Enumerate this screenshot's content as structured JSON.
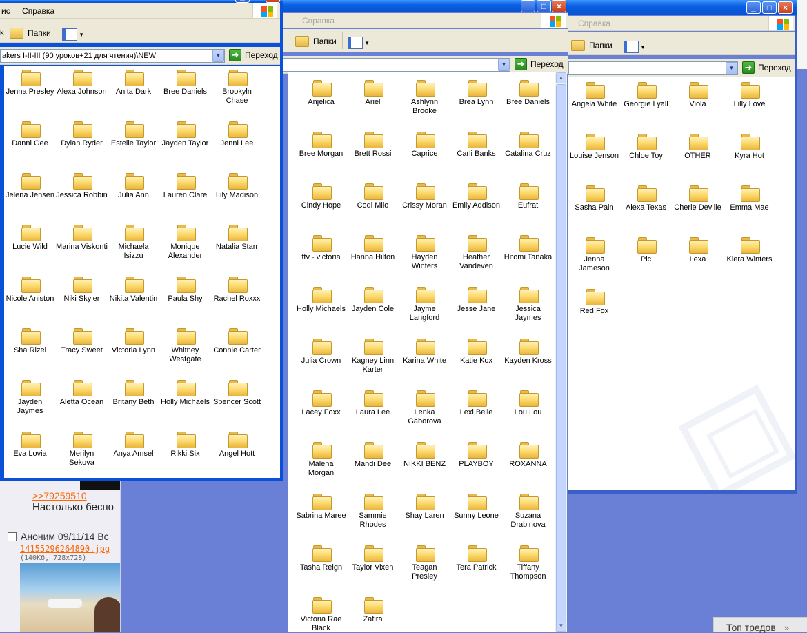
{
  "background_page": {
    "link": ">>79259510",
    "text": "Настолько беспо",
    "post_header": "Аноним 09/11/14 Вс",
    "file_name": "14155296264890.jpg",
    "file_info": "(140Кб, 728x728)",
    "bottom_bar": "Топ тредов",
    "bottom_chevron": "»"
  },
  "windows": [
    {
      "id": "left",
      "menu": [
        "ис",
        "Справка"
      ],
      "folders_label": "Папки",
      "address": "akers I-II-III (90 уроков+21 для чтения)\\NEW",
      "go_label": "Переход",
      "buttons": [
        "_",
        "□",
        "×"
      ],
      "items": [
        [
          "Jenna Presley",
          "Alexa Johnson",
          "Anita Dark",
          "Bree Daniels",
          "Brookyln Chase"
        ],
        [
          "Danni Gee",
          "Dylan Ryder",
          "Estelle Taylor",
          "Jayden Taylor",
          "Jenni Lee"
        ],
        [
          "Jelena Jensen",
          "Jessica Robbin",
          "Julia Ann",
          "Lauren Clare",
          "Lily Madison"
        ],
        [
          "Lucie Wild",
          "Marina Viskonti",
          "Michaela Isizzu",
          "Monique Alexander",
          "Natalia Starr"
        ],
        [
          "Nicole Aniston",
          "Niki Skyler",
          "Nikita Valentin",
          "Paula Shy",
          "Rachel Roxxx"
        ],
        [
          "Sha Rizel",
          "Tracy Sweet",
          "Victoria Lynn",
          "Whitney Westgate",
          "Connie Carter"
        ],
        [
          "Jayden Jaymes",
          "Aletta Ocean",
          "Britany Beth",
          "Holly Michaels",
          "Spencer Scott"
        ],
        [
          "Eva Lovia",
          "Merilyn Sekova",
          "Anya Amsel",
          "Rikki Six",
          "Angel Hott"
        ]
      ]
    },
    {
      "id": "middle",
      "menu": [
        "Справка"
      ],
      "folders_label": "Папки",
      "address": "",
      "go_label": "Переход",
      "buttons": [
        "_",
        "□",
        "×"
      ],
      "items": [
        [
          "Anjelica",
          "Ariel",
          "Ashlynn Brooke",
          "Brea Lynn",
          "Bree Daniels"
        ],
        [
          "Bree Morgan",
          "Brett Rossi",
          "Caprice",
          "Carli Banks",
          "Catalina Cruz"
        ],
        [
          "Cindy Hope",
          "Codi Milo",
          "Crissy Moran",
          "Emily Addison",
          "Eufrat"
        ],
        [
          "ftv - victoria",
          "Hanna Hilton",
          "Hayden Winters",
          "Heather Vandeven",
          "Hitomi Tanaka"
        ],
        [
          "Holly Michaels",
          "Jayden Cole",
          "Jayme Langford",
          "Jesse Jane",
          "Jessica Jaymes"
        ],
        [
          "Julia Crown",
          "Kagney Linn Karter",
          "Karina White",
          "Katie Kox",
          "Kayden Kross"
        ],
        [
          "Lacey Foxx",
          "Laura Lee",
          "Lenka Gaborova",
          "Lexi Belle",
          "Lou Lou"
        ],
        [
          "Malena Morgan",
          "Mandi Dee",
          "NIKKI BENZ",
          "PLAYBOY",
          "ROXANNA"
        ],
        [
          "Sabrina Maree",
          "Sammie Rhodes",
          "Shay Laren",
          "Sunny Leone",
          "Suzana Drabinova"
        ],
        [
          "Tasha Reign",
          "Taylor Vixen",
          "Teagan Presley",
          "Tera Patrick",
          "Tiffany Thompson"
        ],
        [
          "Victoria Rae Black",
          "Zafira"
        ]
      ]
    },
    {
      "id": "right",
      "menu": [
        "Справка"
      ],
      "folders_label": "Папки",
      "address": "",
      "go_label": "Переход",
      "buttons": [
        "_",
        "□",
        "×"
      ],
      "items": [
        [
          "Angela White",
          "Georgie Lyall",
          "Viola",
          "Lilly Love"
        ],
        [
          "Louise Jenson",
          "Chloe Toy",
          "OTHER",
          "Kyra Hot"
        ],
        [
          "Sasha Pain",
          "Alexa Texas",
          "Cherie Deville",
          "Emma Mae"
        ],
        [
          "Jenna Jameson",
          "Pic",
          "Lexa",
          "Kiera Winters"
        ],
        [
          "Red Fox"
        ]
      ]
    }
  ],
  "colors": {
    "desktop": "#6a7fd6",
    "titlebar": "#0a5fe2",
    "chrome": "#ece9d8",
    "link": "#ff6600"
  },
  "icons": {
    "folder": "folder-icon",
    "go": "go-arrow-icon",
    "views": "views-icon",
    "windows_logo": "windows-logo-icon"
  }
}
